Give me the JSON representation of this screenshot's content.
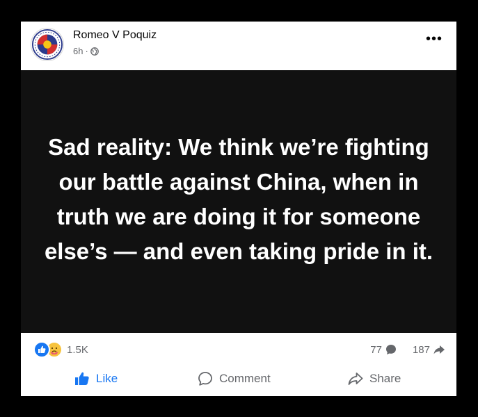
{
  "post": {
    "author": "Romeo V Poquiz",
    "time": "6h",
    "separator": "·",
    "more_label": "•••",
    "text": "Sad reality: We think we’re fighting our battle against China, when in truth we are doing it for someone else’s — and even taking pride in it.",
    "background_color": "#111111"
  },
  "stats": {
    "reactions": [
      "like-icon",
      "care-icon"
    ],
    "reaction_count": "1.5K",
    "comment_count": "77",
    "share_count": "187"
  },
  "actions": {
    "like_label": "Like",
    "comment_label": "Comment",
    "share_label": "Share"
  },
  "colors": {
    "accent": "#1877f2",
    "muted": "#65676b"
  }
}
